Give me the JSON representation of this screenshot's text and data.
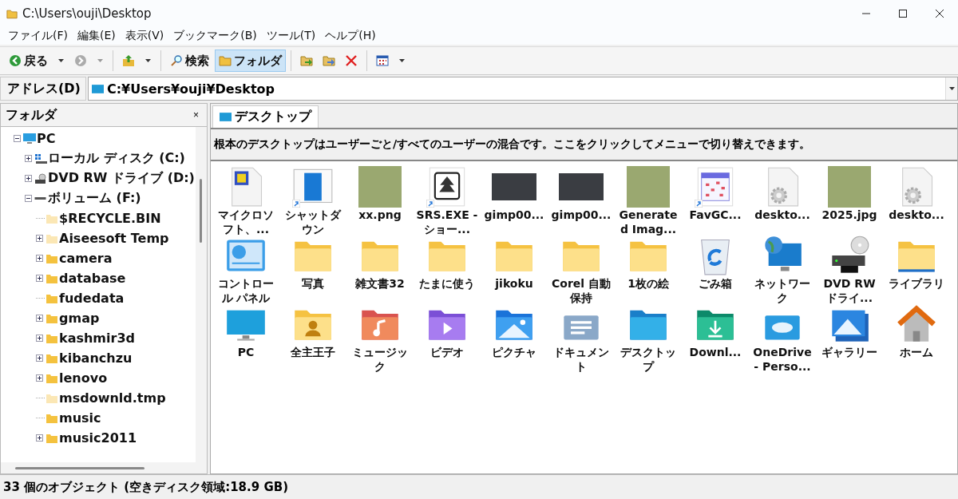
{
  "window": {
    "title": "C:\\Users\\ouji\\Desktop"
  },
  "menu": [
    "ファイル(F)",
    "編集(E)",
    "表示(V)",
    "ブックマーク(B)",
    "ツール(T)",
    "ヘルプ(H)"
  ],
  "toolbar": [
    {
      "kind": "back",
      "label": "戻る",
      "disabled": false,
      "selected": false
    },
    {
      "kind": "forward",
      "disabled": true,
      "selected": false
    },
    {
      "kind": "up",
      "disabled": false,
      "selected": false
    },
    {
      "kind": "search",
      "label": "検索",
      "disabled": false,
      "selected": false
    },
    {
      "kind": "folders",
      "label": "フォルダ",
      "disabled": false,
      "selected": true
    },
    {
      "kind": "move",
      "disabled": false,
      "selected": false
    },
    {
      "kind": "copy",
      "disabled": false,
      "selected": false
    },
    {
      "kind": "delete",
      "disabled": false,
      "selected": false
    },
    {
      "kind": "view",
      "disabled": false,
      "selected": false
    }
  ],
  "address": {
    "label": "アドレス(D)",
    "value": "C:¥Users¥ouji¥Desktop"
  },
  "sidebar": {
    "title": "フォルダ",
    "close": "×",
    "tree": [
      {
        "label": "PC",
        "kind": "pc",
        "expanded": true,
        "children": [
          {
            "label": "ローカル ディスク (C:)",
            "kind": "disk",
            "expanded": false
          },
          {
            "label": "DVD RW ドライブ (D:)",
            "kind": "dvd",
            "expanded": false
          },
          {
            "label": "ボリューム (F:)",
            "kind": "volume",
            "expanded": true,
            "children": [
              {
                "label": "$RECYCLE.BIN",
                "kind": "folder",
                "hidden": true
              },
              {
                "label": "Aiseesoft Temp",
                "kind": "folder",
                "hidden": true,
                "expanded": false
              },
              {
                "label": "camera",
                "kind": "folder",
                "hidden": false,
                "expanded": false
              },
              {
                "label": "database",
                "kind": "folder",
                "hidden": false,
                "expanded": false
              },
              {
                "label": "fudedata",
                "kind": "folder",
                "hidden": false
              },
              {
                "label": "gmap",
                "kind": "folder",
                "hidden": false,
                "expanded": false
              },
              {
                "label": "kashmir3d",
                "kind": "folder",
                "hidden": false,
                "expanded": false
              },
              {
                "label": "kibanchzu",
                "kind": "folder",
                "hidden": false,
                "expanded": false
              },
              {
                "label": "lenovo",
                "kind": "folder",
                "hidden": false,
                "expanded": false
              },
              {
                "label": "msdownld.tmp",
                "kind": "folder",
                "hidden": true
              },
              {
                "label": "music",
                "kind": "folder",
                "hidden": false
              },
              {
                "label": "music2011",
                "kind": "folder",
                "hidden": false,
                "expanded": false
              }
            ]
          }
        ]
      }
    ]
  },
  "tabs": [
    {
      "label": "デスクトップ",
      "selected": true
    }
  ],
  "info_bar": "根本のデスクトップはユーザーごと/すべてのユーザーの混合です。ここをクリックしてメニューで切り替えできます。",
  "items": [
    {
      "label": "マイクロソフト、...",
      "kind": "document",
      "shortcut": false
    },
    {
      "label": "シャットダウン",
      "kind": "window",
      "shortcut": true
    },
    {
      "label": "xx.png",
      "kind": "photo",
      "shortcut": false
    },
    {
      "label": "SRS.EXE - ショー...",
      "kind": "app",
      "shortcut": true
    },
    {
      "label": "gimp00...",
      "kind": "screenshot",
      "shortcut": false
    },
    {
      "label": "gimp00...",
      "kind": "screenshot",
      "shortcut": false
    },
    {
      "label": "Generated Imag...",
      "kind": "photo",
      "shortcut": false
    },
    {
      "label": "FavGC...",
      "kind": "calendar",
      "shortcut": true
    },
    {
      "label": "deskto...",
      "kind": "settings-file",
      "shortcut": false
    },
    {
      "label": "2025.jpg",
      "kind": "photo",
      "shortcut": false
    },
    {
      "label": "deskto...",
      "kind": "settings-file",
      "shortcut": false
    },
    {
      "label": "コントロール パネル",
      "kind": "control-panel",
      "shortcut": false
    },
    {
      "label": "写真",
      "kind": "folder",
      "shortcut": false
    },
    {
      "label": "雑文書32",
      "kind": "folder",
      "shortcut": false
    },
    {
      "label": "たまに使う",
      "kind": "folder",
      "shortcut": false
    },
    {
      "label": "jikoku",
      "kind": "folder",
      "shortcut": false
    },
    {
      "label": "Corel 自動保持",
      "kind": "folder",
      "shortcut": false
    },
    {
      "label": "1枚の絵",
      "kind": "folder",
      "shortcut": false
    },
    {
      "label": "ごみ箱",
      "kind": "recycle-bin",
      "shortcut": false
    },
    {
      "label": "ネットワーク",
      "kind": "network",
      "shortcut": false
    },
    {
      "label": "DVD RW ドライ...",
      "kind": "dvd",
      "shortcut": false
    },
    {
      "label": "ライブラリ",
      "kind": "library",
      "shortcut": false
    },
    {
      "label": "PC",
      "kind": "pc",
      "shortcut": false
    },
    {
      "label": "全主王子",
      "kind": "user",
      "shortcut": false
    },
    {
      "label": "ミュージック",
      "kind": "music",
      "shortcut": false
    },
    {
      "label": "ビデオ",
      "kind": "video",
      "shortcut": false
    },
    {
      "label": "ピクチャ",
      "kind": "pictures",
      "shortcut": false
    },
    {
      "label": "ドキュメント",
      "kind": "documents",
      "shortcut": false
    },
    {
      "label": "デスクトップ",
      "kind": "desktop",
      "shortcut": false
    },
    {
      "label": "Downl...",
      "kind": "downloads",
      "shortcut": false
    },
    {
      "label": "OneDrive - Perso...",
      "kind": "onedrive",
      "shortcut": false
    },
    {
      "label": "ギャラリー",
      "kind": "gallery",
      "shortcut": false
    },
    {
      "label": "ホーム",
      "kind": "home",
      "shortcut": false
    }
  ],
  "status_bar": "33 個のオブジェクト (空きディスク領域:18.9 GB)"
}
